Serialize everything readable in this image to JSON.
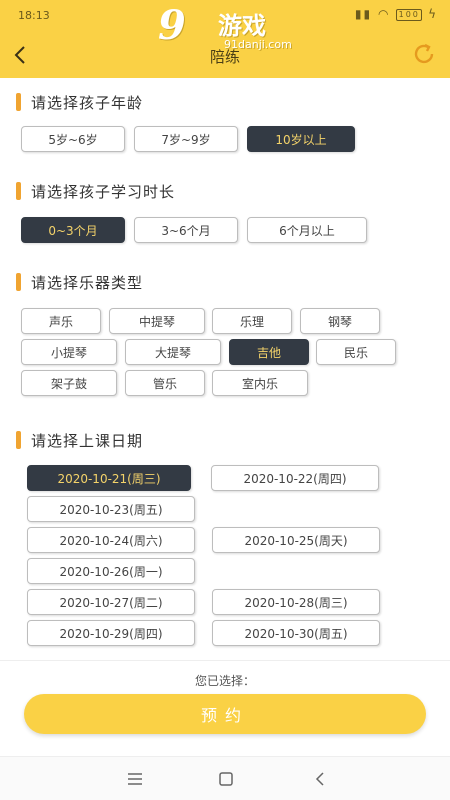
{
  "status": {
    "time": "18:13",
    "battery": "100"
  },
  "watermark": {
    "logo": "9",
    "brand": "游戏",
    "url": "91danji.com"
  },
  "header": {
    "title": "陪练"
  },
  "age": {
    "title": "请选择孩子年龄",
    "options": [
      "5岁~6岁",
      "7岁~9岁",
      "10岁以上"
    ]
  },
  "duration": {
    "title": "请选择孩子学习时长",
    "options": [
      "0~3个月",
      "3~6个月",
      "6个月以上"
    ]
  },
  "instrument": {
    "title": "请选择乐器类型",
    "options": [
      "声乐",
      "中提琴",
      "乐理",
      "钢琴",
      "小提琴",
      "大提琴",
      "吉他",
      "民乐",
      "架子鼓",
      "管乐",
      "室内乐"
    ]
  },
  "date": {
    "title": "请选择上课日期",
    "options": [
      "2020-10-21(周三)",
      "2020-10-22(周四)",
      "2020-10-23(周五)",
      "2020-10-24(周六)",
      "2020-10-25(周天)",
      "2020-10-26(周一)",
      "2020-10-27(周二)",
      "2020-10-28(周三)",
      "2020-10-29(周四)",
      "2020-10-30(周五)"
    ]
  },
  "footer": {
    "summary": "您已选择：",
    "book_label": "预约"
  },
  "colors": {
    "accent": "#fad145",
    "selected_bg": "#333a44",
    "selected_text": "#f4d36a",
    "section_bar": "#f0a431"
  }
}
